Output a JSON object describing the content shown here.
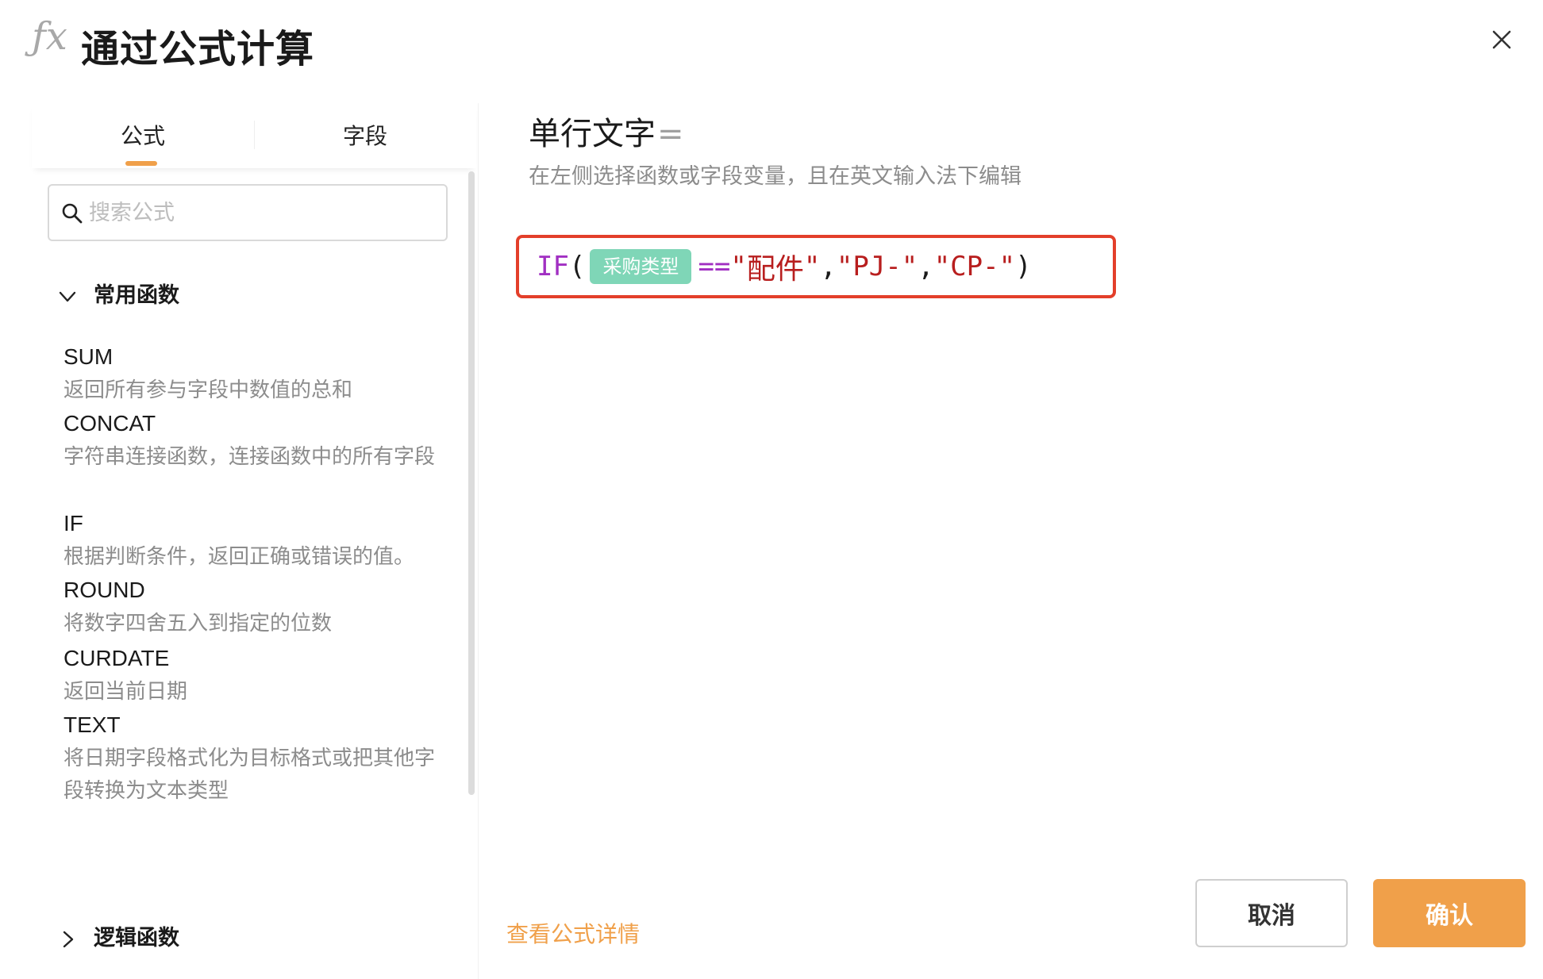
{
  "header": {
    "icon_glyph": "ƒx",
    "title": "通过公式计算",
    "close_icon": "close-icon"
  },
  "tabs": [
    {
      "label": "公式",
      "active": true
    },
    {
      "label": "字段",
      "active": false
    }
  ],
  "search": {
    "placeholder": "搜索公式",
    "value": ""
  },
  "groups": {
    "common": {
      "label": "常用函数",
      "expanded": true
    },
    "logic": {
      "label": "逻辑函数",
      "expanded": false
    }
  },
  "functions": [
    {
      "name": "SUM",
      "desc": "返回所有参与字段中数值的总和"
    },
    {
      "name": "CONCAT",
      "desc": "字符串连接函数，连接函数中的所有字段"
    },
    {
      "name": "IF",
      "desc": "根据判断条件，返回正确或错误的值。"
    },
    {
      "name": "ROUND",
      "desc": "将数字四舍五入到指定的位数"
    },
    {
      "name": "CURDATE",
      "desc": "返回当前日期"
    },
    {
      "name": "TEXT",
      "desc": "将日期字段格式化为目标格式或把其他字段转换为文本类型"
    }
  ],
  "editor": {
    "field_label": "单行文字",
    "equals": "=",
    "hint": "在左侧选择函数或字段变量，且在英文输入法下编辑",
    "tokens": {
      "fn": "IF",
      "open": "(",
      "chip": "采购类型",
      "op": "==",
      "q1": "\"",
      "str1": "配件",
      "q2": "\"",
      "comma1": ",",
      "str2": "\"PJ-\"",
      "comma2": ",",
      "str3": "\"CP-\"",
      "close": ")"
    }
  },
  "footer": {
    "detail_link": "查看公式详情",
    "cancel": "取消",
    "confirm": "确认"
  },
  "colors": {
    "accent": "#f0a04a",
    "highlight_border": "#e33f2a",
    "field_chip": "#7fd6b7",
    "fn_token": "#a12fc2",
    "string_token": "#b81e1e"
  }
}
